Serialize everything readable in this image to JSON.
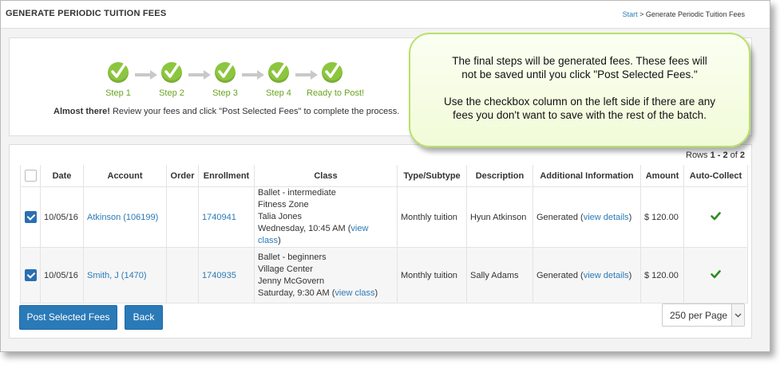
{
  "header": {
    "title": "GENERATE PERIODIC TUITION FEES",
    "breadcrumb_start": "Start",
    "breadcrumb_sep": " > ",
    "breadcrumb_current": "Generate Periodic Tuition Fees"
  },
  "steps": [
    {
      "label": "Step 1"
    },
    {
      "label": "Step 2"
    },
    {
      "label": "Step 3"
    },
    {
      "label": "Step 4"
    },
    {
      "label": "Ready to Post!"
    }
  ],
  "almost": {
    "bold": "Almost there!",
    "text": " Review your fees and click \"Post Selected Fees\" to complete the process."
  },
  "table": {
    "rows_prefix": "Rows ",
    "rows_range": "1 - 2",
    "rows_of": " of ",
    "rows_total": "2",
    "headers": {
      "date": "Date",
      "account": "Account",
      "order": "Order",
      "enrollment": "Enrollment",
      "class": "Class",
      "type": "Type/Subtype",
      "description": "Description",
      "additional": "Additional Information",
      "amount": "Amount",
      "autocollect": "Auto-Collect"
    },
    "rows": [
      {
        "date": "10/05/16",
        "account": "Atkinson (106199)",
        "order": "",
        "enrollment": "1740941",
        "class_name": "Ballet - intermediate",
        "class_location": "Fitness Zone",
        "class_instructor": "Talia Jones",
        "class_time": "Wednesday, 10:45 AM (",
        "class_view": "view class",
        "class_close": ")",
        "type": "Monthly tuition",
        "description": "Hyun Atkinson",
        "additional_pre": "Generated (",
        "additional_link": "view details",
        "additional_post": ")",
        "amount": "$ 120.00"
      },
      {
        "date": "10/05/16",
        "account": "Smith, J (1470)",
        "order": "",
        "enrollment": "1740935",
        "class_name": "Ballet - beginners",
        "class_location": "Village Center",
        "class_instructor": "Jenny McGovern",
        "class_time": "Saturday, 9:30 AM (",
        "class_view": "view class",
        "class_close": ")",
        "type": "Monthly tuition",
        "description": "Sally Adams",
        "additional_pre": "Generated (",
        "additional_link": "view details",
        "additional_post": ")",
        "amount": "$ 120.00"
      }
    ]
  },
  "buttons": {
    "post": "Post Selected Fees",
    "back": "Back"
  },
  "per_page": "250 per Page",
  "callout": {
    "line1": "The final steps will be generated fees. These fees will",
    "line2": "not be saved until you click \"Post Selected Fees.\"",
    "line3": "Use the checkbox column on the left side if there are any",
    "line4": "fees you don't want to save with the rest of the batch."
  },
  "colors": {
    "accent": "#2a7ab8",
    "step_green": "#8cc63f",
    "autocollect_green": "#2e8b22"
  }
}
